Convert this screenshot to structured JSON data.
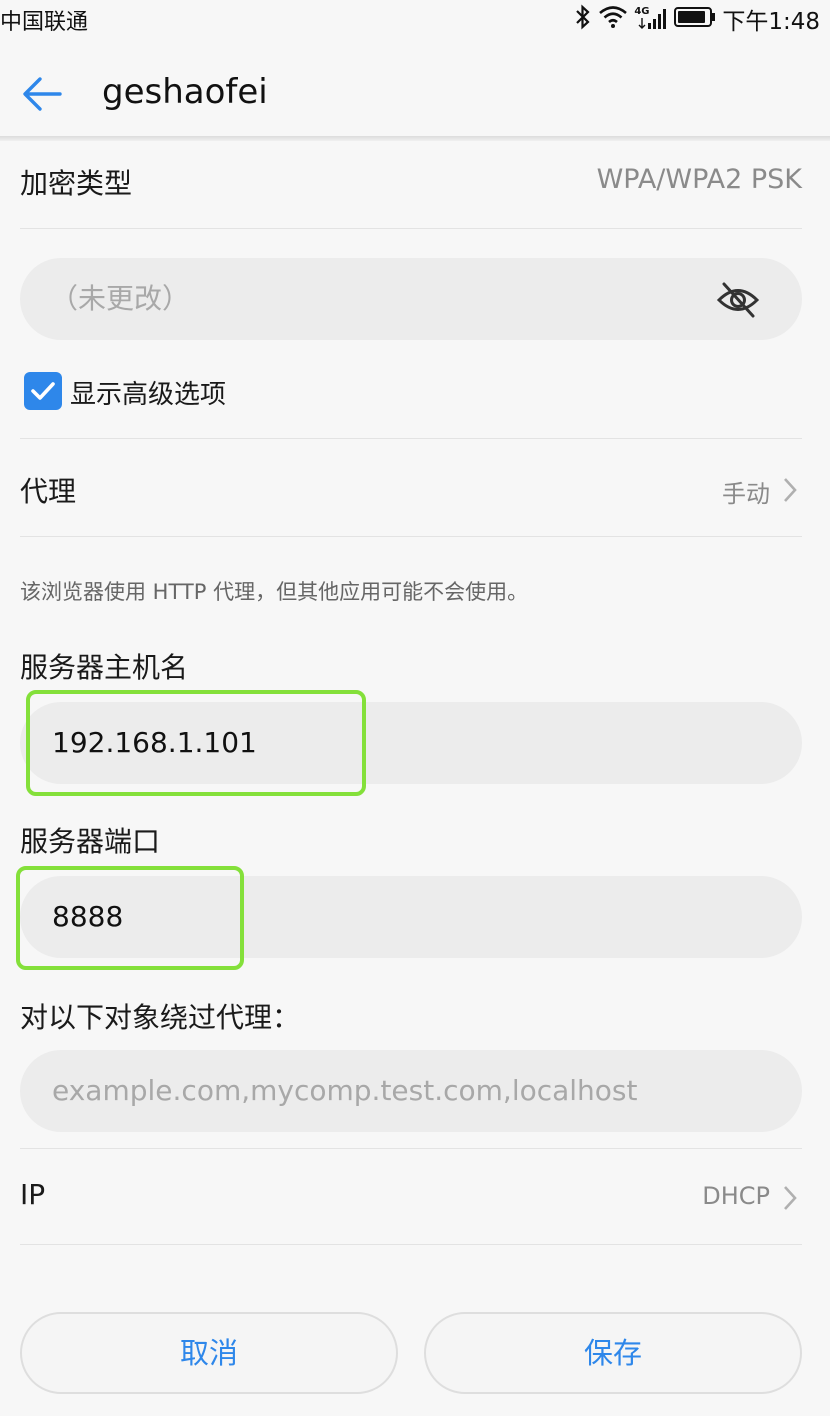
{
  "status_bar": {
    "carrier": "中国联通",
    "network": "4G",
    "time": "下午1:48"
  },
  "header": {
    "title": "geshaofei"
  },
  "security": {
    "label": "加密类型",
    "value": "WPA/WPA2 PSK"
  },
  "password": {
    "placeholder": "（未更改）"
  },
  "advanced": {
    "label": "显示高级选项",
    "checked": true
  },
  "proxy": {
    "label": "代理",
    "value": "手动"
  },
  "proxy_note": "该浏览器使用 HTTP 代理，但其他应用可能不会使用。",
  "host": {
    "label": "服务器主机名",
    "value": "192.168.1.101"
  },
  "port": {
    "label": "服务器端口",
    "value": "8888"
  },
  "bypass": {
    "label": "对以下对象绕过代理：",
    "placeholder": "example.com,mycomp.test.com,localhost"
  },
  "ip": {
    "label": "IP",
    "value": "DHCP"
  },
  "buttons": {
    "cancel": "取消",
    "save": "保存"
  },
  "colors": {
    "accent": "#2e87ea",
    "highlight": "#84e03a"
  }
}
